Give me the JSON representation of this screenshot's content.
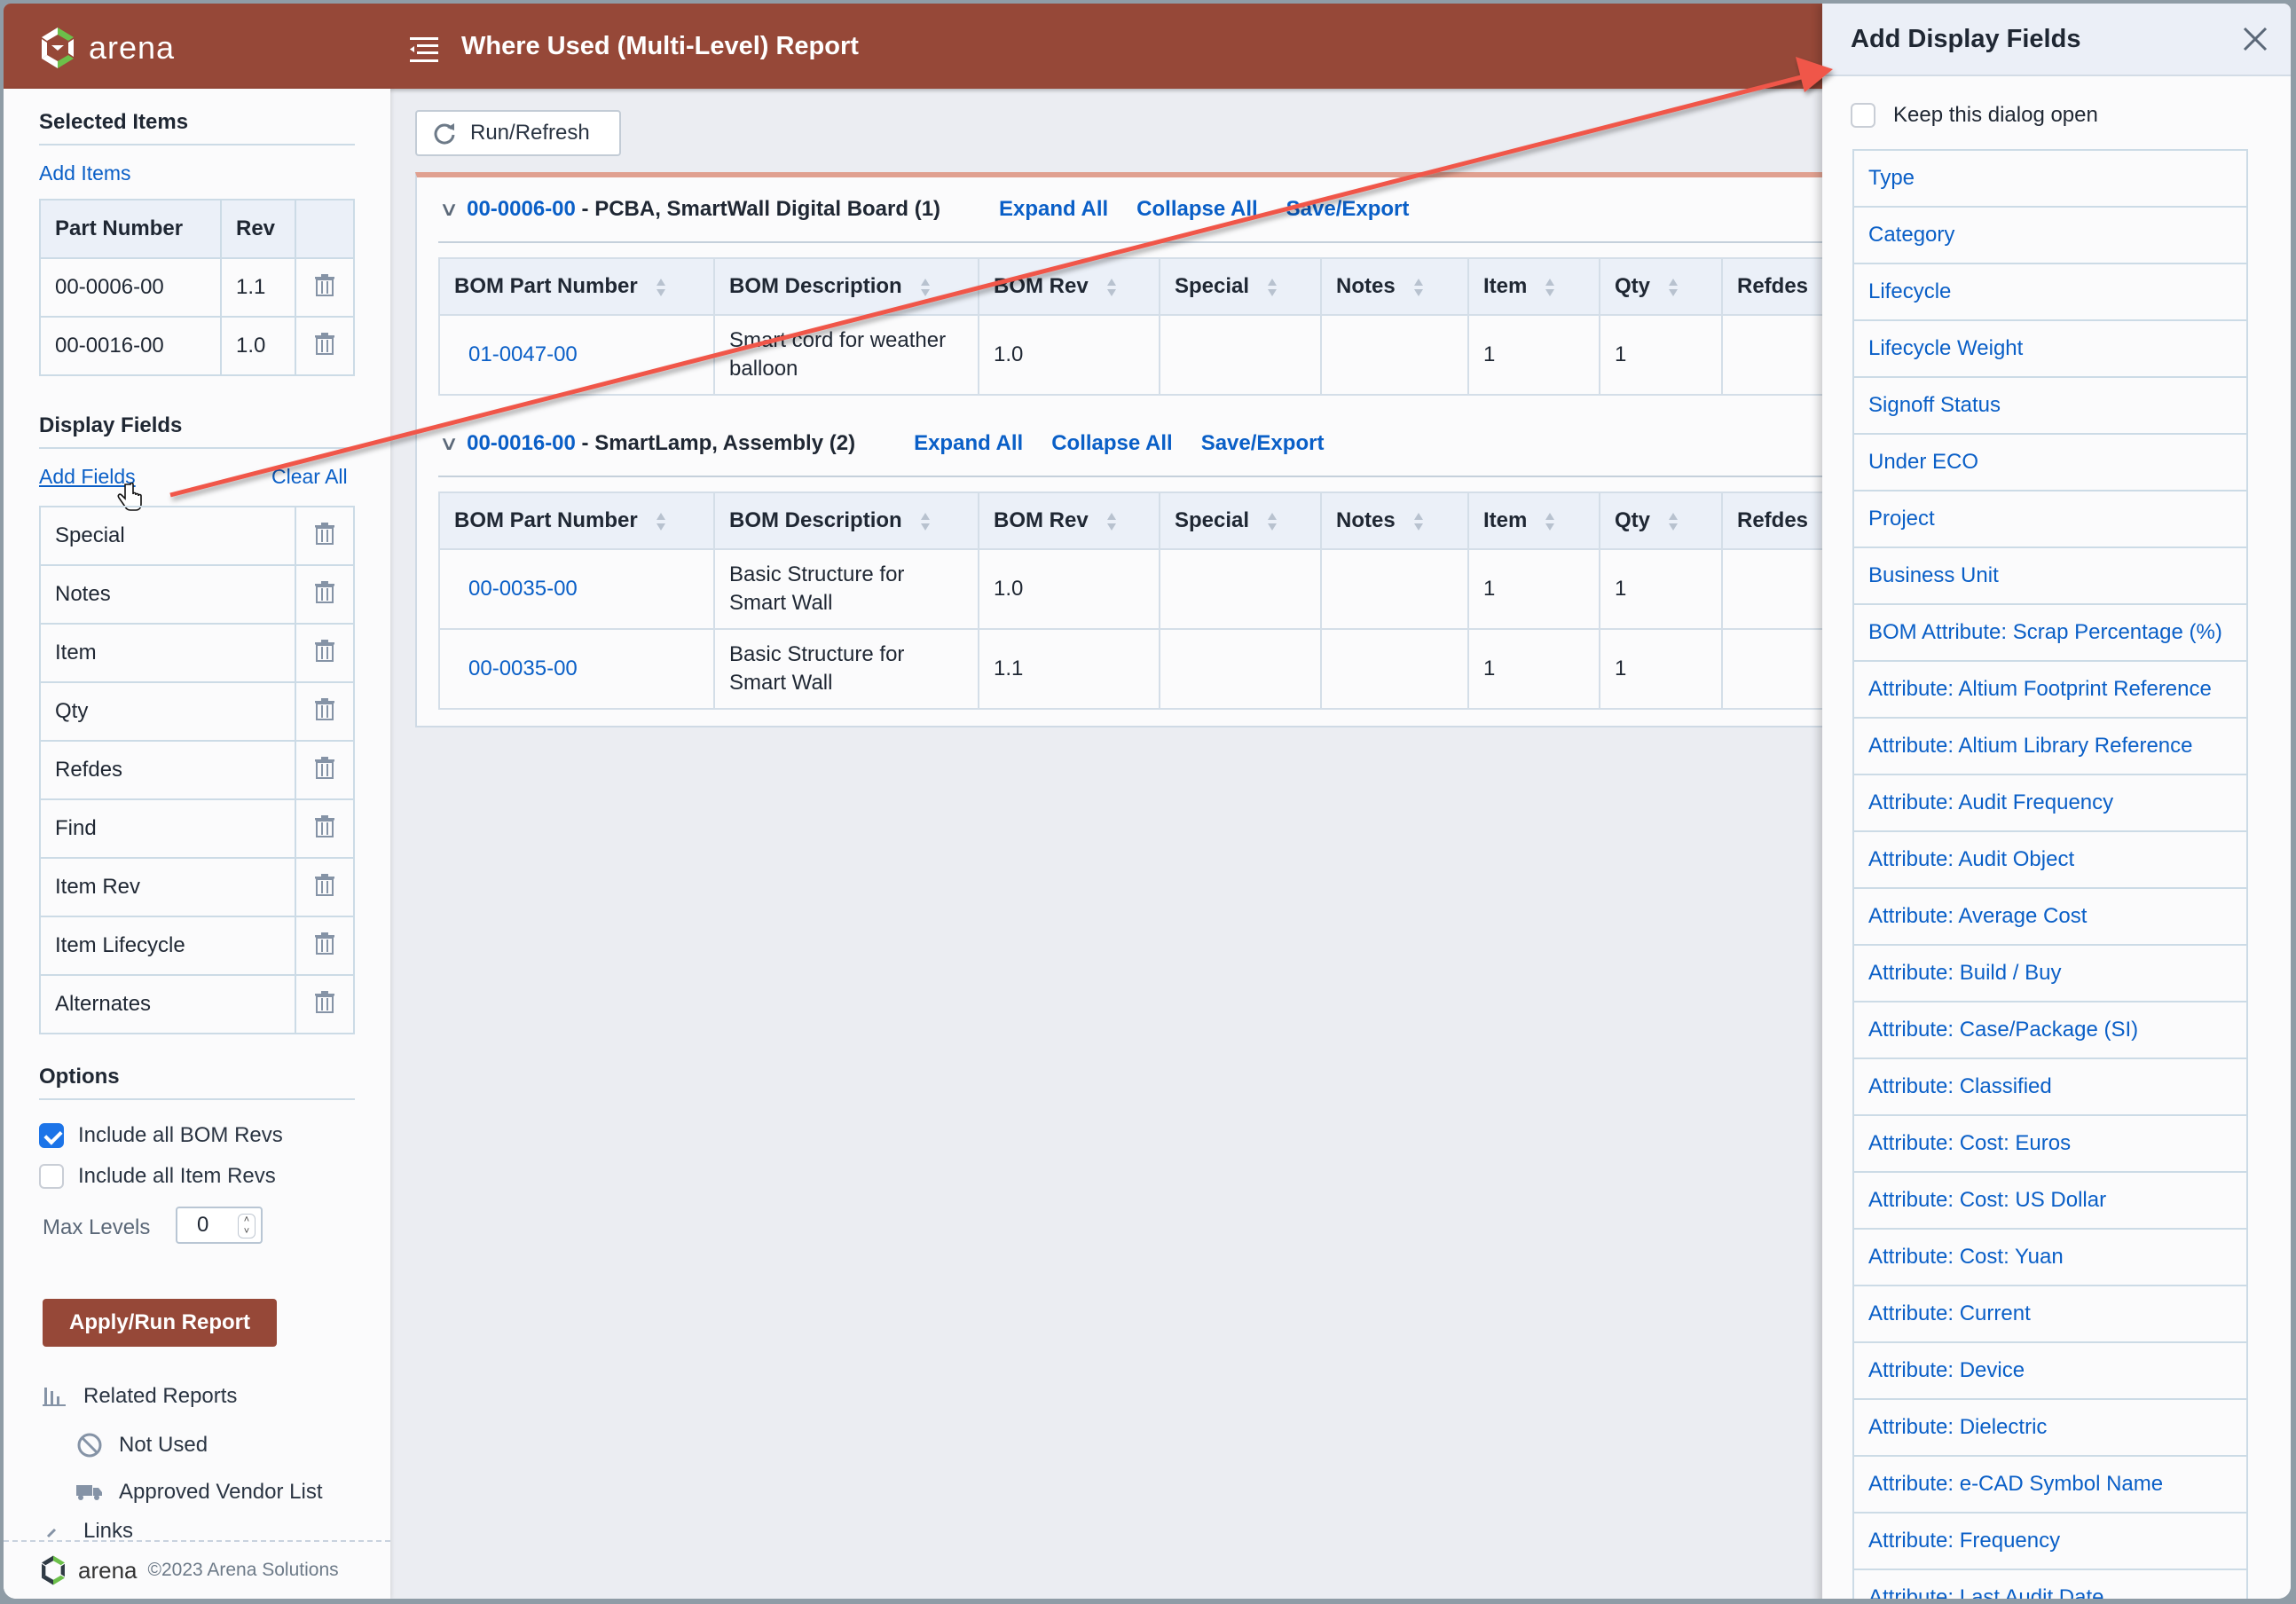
{
  "header": {
    "logo_text": "arena",
    "title": "Where Used (Multi-Level) Report"
  },
  "sidebar": {
    "selected_items": {
      "title": "Selected Items",
      "add_link": "Add Items",
      "columns": [
        "Part Number",
        "Rev",
        ""
      ],
      "rows": [
        {
          "part_number": "00-0006-00",
          "rev": "1.1"
        },
        {
          "part_number": "00-0016-00",
          "rev": "1.0"
        }
      ]
    },
    "display_fields": {
      "title": "Display Fields",
      "add_link": "Add Fields",
      "clear_link": "Clear All",
      "fields": [
        "Special",
        "Notes",
        "Item",
        "Qty",
        "Refdes",
        "Find",
        "Item Rev",
        "Item Lifecycle",
        "Alternates"
      ]
    },
    "options": {
      "title": "Options",
      "include_bom_revs": {
        "label": "Include all BOM Revs",
        "checked": true
      },
      "include_item_revs": {
        "label": "Include all Item Revs",
        "checked": false
      },
      "max_levels_label": "Max Levels",
      "max_levels_value": "0",
      "apply_button": "Apply/Run Report"
    },
    "related_reports": {
      "title": "Related Reports",
      "items": [
        "Not Used",
        "Approved Vendor List"
      ],
      "links_label": "Links"
    },
    "footer": {
      "logo_text": "arena",
      "copyright": "©2023 Arena Solutions"
    }
  },
  "main": {
    "run_button": "Run/Refresh",
    "columns": [
      "BOM Part Number",
      "BOM Description",
      "BOM Rev",
      "Special",
      "Notes",
      "Item",
      "Qty",
      "Refdes"
    ],
    "groups": [
      {
        "part_number": "00-0006-00",
        "title": " - PCBA, SmartWall Digital Board (1)",
        "actions": [
          "Expand All",
          "Collapse All",
          "Save/Export"
        ],
        "rows": [
          {
            "bom_part_number": "01-0047-00",
            "bom_description": "Smart cord for weather balloon",
            "bom_rev": "1.0",
            "special": "",
            "notes": "",
            "item": "1",
            "qty": "1",
            "refdes": ""
          }
        ]
      },
      {
        "part_number": "00-0016-00",
        "title": " - SmartLamp, Assembly (2)",
        "actions": [
          "Expand All",
          "Collapse All",
          "Save/Export"
        ],
        "rows": [
          {
            "bom_part_number": "00-0035-00",
            "bom_description": "Basic Structure for Smart Wall",
            "bom_rev": "1.0",
            "special": "",
            "notes": "",
            "item": "1",
            "qty": "1",
            "refdes": ""
          },
          {
            "bom_part_number": "00-0035-00",
            "bom_description": "Basic Structure for Smart Wall",
            "bom_rev": "1.1",
            "special": "",
            "notes": "",
            "item": "1",
            "qty": "1",
            "refdes": ""
          }
        ]
      }
    ]
  },
  "dialog": {
    "title": "Add Display Fields",
    "keep_open_label": "Keep this dialog open",
    "keep_open_checked": false,
    "fields": [
      "Type",
      "Category",
      "Lifecycle",
      "Lifecycle Weight",
      "Signoff Status",
      "Under ECO",
      "Project",
      "Business Unit",
      "BOM Attribute: Scrap Percentage (%)",
      "Attribute: Altium Footprint Reference",
      "Attribute: Altium Library Reference",
      "Attribute: Audit Frequency",
      "Attribute: Audit Object",
      "Attribute: Average Cost",
      "Attribute: Build / Buy",
      "Attribute: Case/Package (SI)",
      "Attribute: Classified",
      "Attribute: Cost: Euros",
      "Attribute: Cost: US Dollar",
      "Attribute: Cost: Yuan",
      "Attribute: Current",
      "Attribute: Device",
      "Attribute: Dielectric",
      "Attribute: e-CAD Symbol Name",
      "Attribute: Frequency",
      "Attribute: Last Audit Date"
    ]
  },
  "colors": {
    "brand": "#964838",
    "link": "#0a5fc7",
    "annotation_arrow": "#f0574a",
    "checkbox_checked": "#1c74e8"
  }
}
